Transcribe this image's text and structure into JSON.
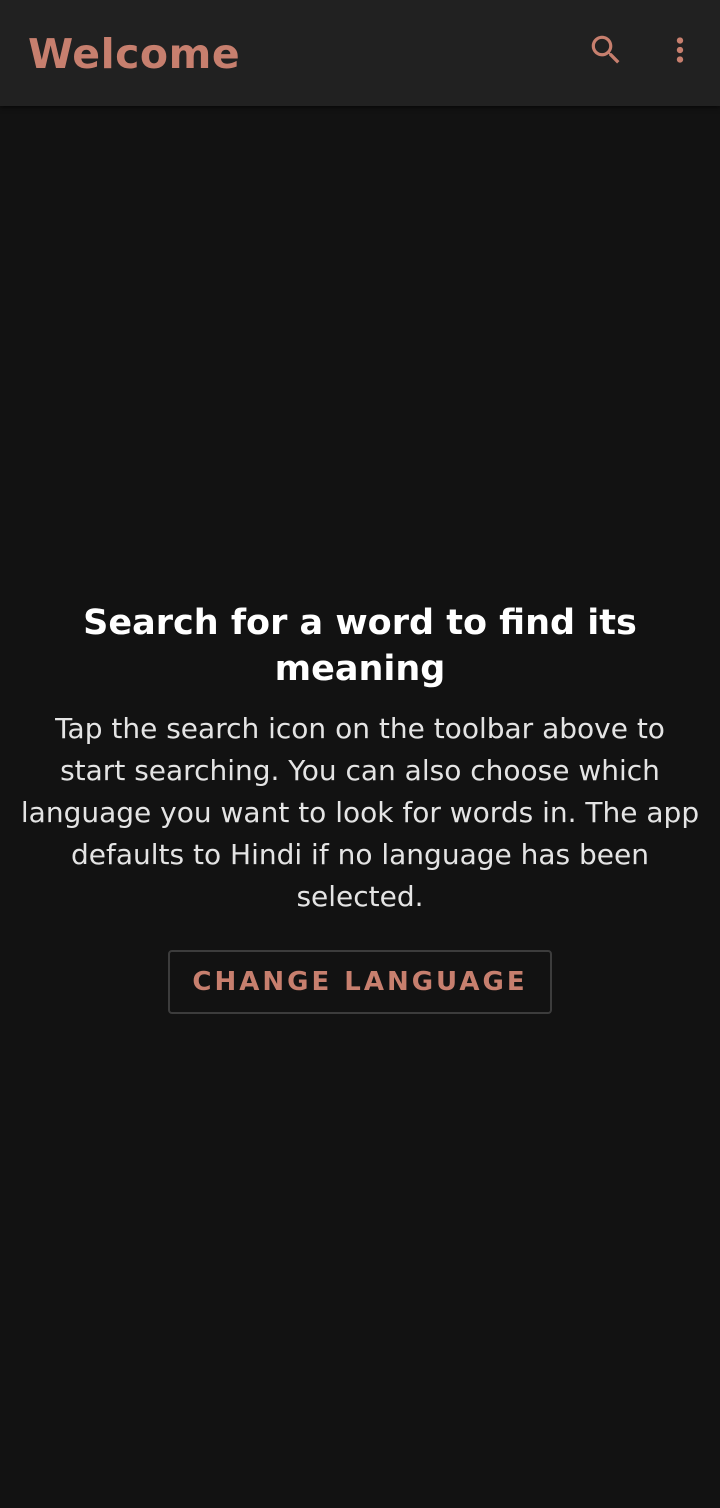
{
  "toolbar": {
    "title": "Welcome",
    "search_icon": "search-icon",
    "more_icon": "more-vert-icon"
  },
  "colors": {
    "accent": "#c77f6e",
    "toolbar_bg": "#212121",
    "screen_bg": "#121212",
    "headline": "#ffffff",
    "body_text": "#e4e4e4"
  },
  "empty_state": {
    "headline": "Search for a word to find its meaning",
    "body": "Tap the search icon on the toolbar above to start searching. You can also choose which language you want to look for words in. The app defaults to Hindi if no language has been selected.",
    "button_label": "CHANGE LANGUAGE"
  }
}
